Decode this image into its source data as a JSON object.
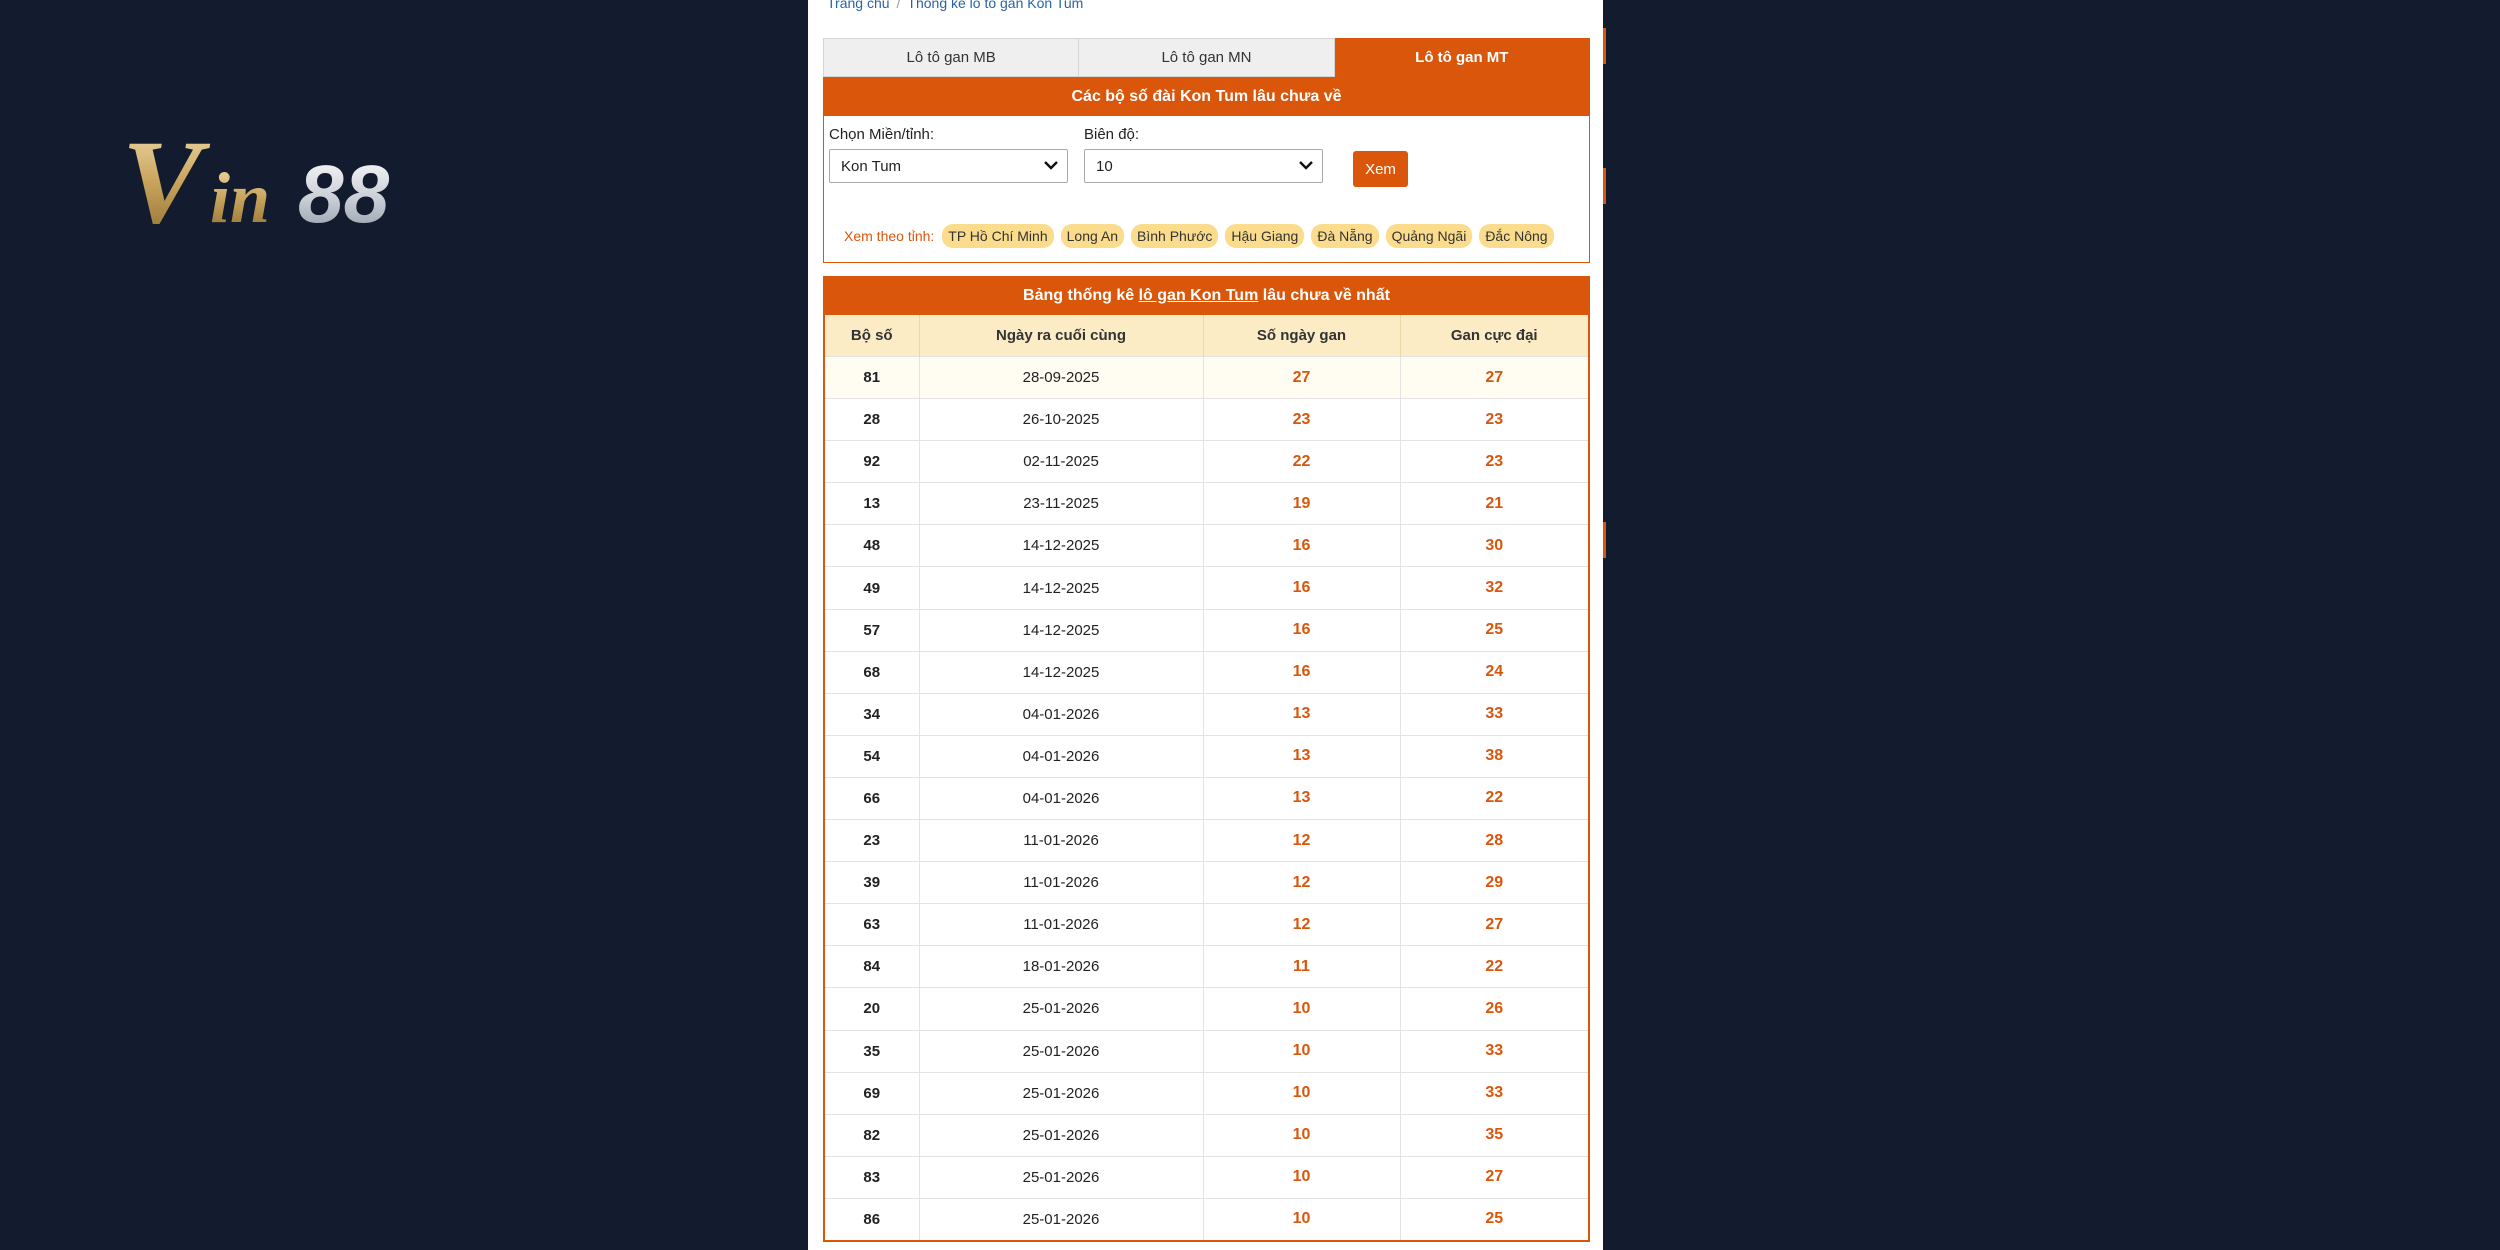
{
  "logo": {
    "text": "Vin88"
  },
  "breadcrumb": {
    "home": "Trang chủ",
    "separator": "/",
    "current": "Thống kê lô tô gan Kon Tum"
  },
  "tabs": [
    {
      "label": "Lô tô gan MB",
      "active": false
    },
    {
      "label": "Lô tô gan MN",
      "active": false
    },
    {
      "label": "Lô tô gan MT",
      "active": true
    }
  ],
  "filter": {
    "header": "Các bộ số đài Kon Tum lâu chưa về",
    "region_label": "Chọn Miền/tỉnh:",
    "region_value": "Kon Tum",
    "range_label": "Biên độ:",
    "range_value": "10",
    "submit_label": "Xem",
    "provinces_label": "Xem theo tỉnh:",
    "provinces": [
      "TP Hồ Chí Minh",
      "Long An",
      "Bình Phước",
      "Hậu Giang",
      "Đà Nẵng",
      "Quảng Ngãi",
      "Đắc Nông"
    ]
  },
  "table": {
    "title_prefix": "Bảng thống kê",
    "title_link": "lô gan Kon Tum",
    "title_suffix": "lâu chưa về nhất",
    "columns": [
      "Bộ số",
      "Ngày ra cuối cùng",
      "Số ngày gan",
      "Gan cực đại"
    ],
    "rows": [
      [
        "81",
        "28-09-2025",
        "27",
        "27"
      ],
      [
        "28",
        "26-10-2025",
        "23",
        "23"
      ],
      [
        "92",
        "02-11-2025",
        "22",
        "23"
      ],
      [
        "13",
        "23-11-2025",
        "19",
        "21"
      ],
      [
        "48",
        "14-12-2025",
        "16",
        "30"
      ],
      [
        "49",
        "14-12-2025",
        "16",
        "32"
      ],
      [
        "57",
        "14-12-2025",
        "16",
        "25"
      ],
      [
        "68",
        "14-12-2025",
        "16",
        "24"
      ],
      [
        "34",
        "04-01-2026",
        "13",
        "33"
      ],
      [
        "54",
        "04-01-2026",
        "13",
        "38"
      ],
      [
        "66",
        "04-01-2026",
        "13",
        "22"
      ],
      [
        "23",
        "11-01-2026",
        "12",
        "28"
      ],
      [
        "39",
        "11-01-2026",
        "12",
        "29"
      ],
      [
        "63",
        "11-01-2026",
        "12",
        "27"
      ],
      [
        "84",
        "18-01-2026",
        "11",
        "22"
      ],
      [
        "20",
        "25-01-2026",
        "10",
        "26"
      ],
      [
        "35",
        "25-01-2026",
        "10",
        "33"
      ],
      [
        "69",
        "25-01-2026",
        "10",
        "33"
      ],
      [
        "82",
        "25-01-2026",
        "10",
        "35"
      ],
      [
        "83",
        "25-01-2026",
        "10",
        "27"
      ],
      [
        "86",
        "25-01-2026",
        "10",
        "25"
      ]
    ]
  },
  "colors": {
    "accent": "#d9560b",
    "background": "#131c2e",
    "header_row": "#fcecc6",
    "chip": "#fadc8c"
  }
}
